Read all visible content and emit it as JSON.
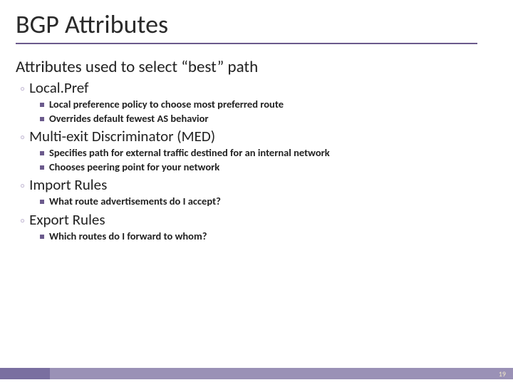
{
  "title": "BGP Attributes",
  "subtitle": "Attributes used to select “best” path",
  "sections": [
    {
      "heading": "Local.Pref",
      "bullets": [
        "Local preference policy to choose most preferred route",
        "Overrides default fewest AS behavior"
      ]
    },
    {
      "heading": "Multi-exit Discriminator (MED)",
      "bullets": [
        "Specifies path for external traffic destined for an internal network",
        "Chooses peering point for your network"
      ]
    },
    {
      "heading": "Import Rules",
      "bullets": [
        "What route advertisements do I accept?"
      ]
    },
    {
      "heading": "Export Rules",
      "bullets": [
        "Which routes do I forward to whom?"
      ]
    }
  ],
  "page_number": "19"
}
